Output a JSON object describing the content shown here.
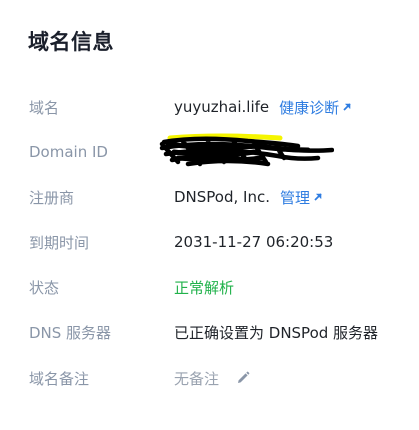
{
  "header": {
    "title": "域名信息"
  },
  "rows": [
    {
      "label": "域名",
      "value": "yuyuzhai.life",
      "link": "健康诊断"
    },
    {
      "label": "Domain ID",
      "value": ""
    },
    {
      "label": "注册商",
      "value": "DNSPod, Inc.",
      "link": "管理"
    },
    {
      "label": "到期时间",
      "value": "2031-11-27 06:20:53"
    },
    {
      "label": "状态",
      "value": "正常解析",
      "value_color": "#21b24b"
    },
    {
      "label": "DNS 服务器",
      "value": "已正确设置为 DNSPod 服务器"
    },
    {
      "label": "域名备注",
      "value": "无备注"
    }
  ],
  "icons": {
    "external_link": "arrow-up-right-icon",
    "edit": "pencil-icon"
  },
  "colors": {
    "link": "#2f7de1",
    "label": "#8a96a8",
    "status_ok": "#21b24b",
    "redaction_highlight": "#f5f500",
    "redaction_scribble": "#000000"
  }
}
